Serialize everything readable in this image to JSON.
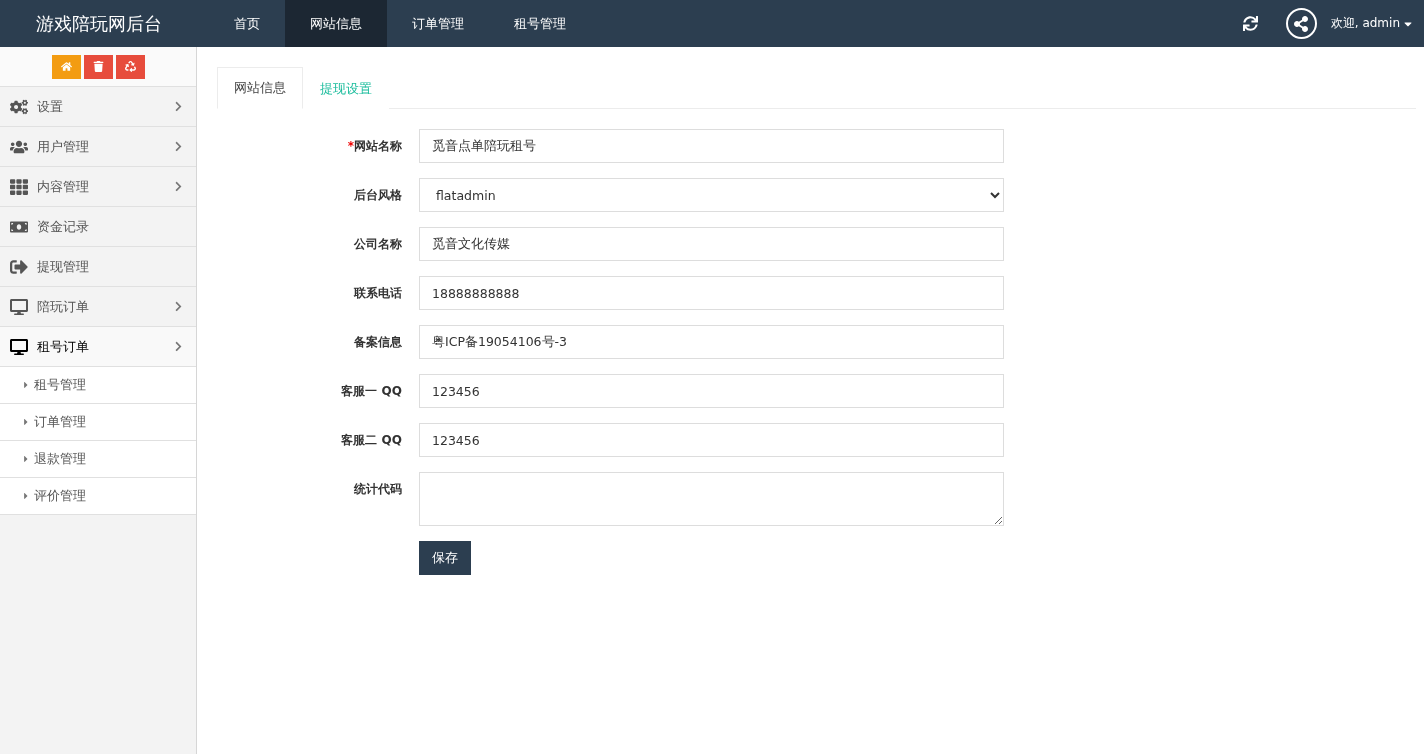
{
  "header": {
    "title": "游戏陪玩网后台",
    "nav": [
      {
        "label": "首页",
        "selected": false
      },
      {
        "label": "网站信息",
        "selected": true
      },
      {
        "label": "订单管理",
        "selected": false
      },
      {
        "label": "租号管理",
        "selected": false
      }
    ],
    "user": "欢迎, admin"
  },
  "sidebar": {
    "items": [
      {
        "label": "设置",
        "kind": "group",
        "expanded": false
      },
      {
        "label": "用户管理",
        "kind": "group",
        "expanded": false
      },
      {
        "label": "内容管理",
        "kind": "group",
        "expanded": false
      },
      {
        "label": "资金记录",
        "kind": "link",
        "expanded": false
      },
      {
        "label": "提现管理",
        "kind": "link",
        "expanded": false
      },
      {
        "label": "陪玩订单",
        "kind": "group",
        "expanded": false
      },
      {
        "label": "租号订单",
        "kind": "group",
        "expanded": true,
        "children": [
          {
            "label": "租号管理"
          },
          {
            "label": "订单管理"
          },
          {
            "label": "退款管理"
          },
          {
            "label": "评价管理"
          }
        ]
      }
    ]
  },
  "tabs": [
    {
      "label": "网站信息",
      "selected": true
    },
    {
      "label": "提现设置",
      "selected": false
    }
  ],
  "form": {
    "fields": [
      {
        "label": "网站名称",
        "required": true,
        "kind": "text",
        "value": "觅音点单陪玩租号"
      },
      {
        "label": "后台风格",
        "required": false,
        "kind": "select",
        "value": "flatadmin"
      },
      {
        "label": "公司名称",
        "required": false,
        "kind": "text",
        "value": "觅音文化传媒"
      },
      {
        "label": "联系电话",
        "required": false,
        "kind": "text",
        "value": "18888888888"
      },
      {
        "label": "备案信息",
        "required": false,
        "kind": "text",
        "value": "粤ICP备19054106号-3"
      },
      {
        "label": "客服一 QQ",
        "required": false,
        "kind": "text",
        "value": "123456"
      },
      {
        "label": "客服二 QQ",
        "required": false,
        "kind": "text",
        "value": "123456"
      },
      {
        "label": "统计代码",
        "required": false,
        "kind": "textarea"
      }
    ],
    "required_mark": "*",
    "submit": "保存"
  }
}
